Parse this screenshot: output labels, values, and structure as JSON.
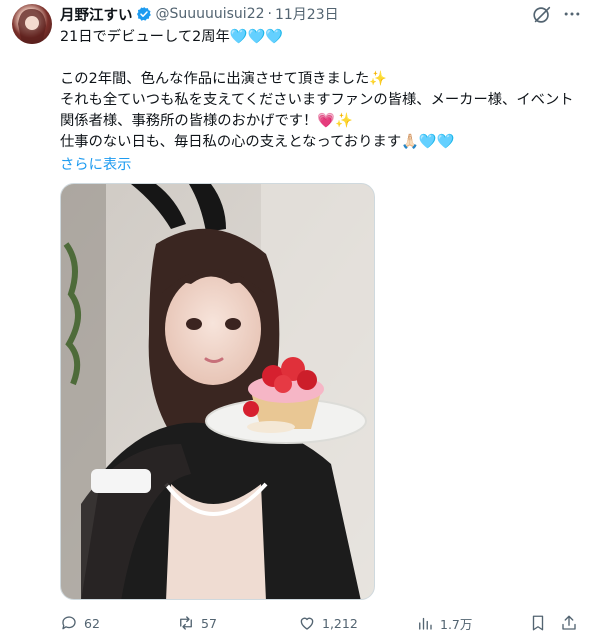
{
  "post": {
    "author_name": "月野江すい",
    "handle": "@Suuuuuisui22",
    "separator": "·",
    "date": "11月23日",
    "text": "21日でデビューして2周年🩵🩵🩵\n\nこの2年間、色んな作品に出演させて頂きました✨\nそれも全ていつも私を支えてくださいますファンの皆様、メーカー様、イベント関係者様、事務所の皆様のおかげです！💗✨\n仕事のない日も、毎日私の心の支えとなっております🙏🏻🩵🩵",
    "show_more": "さらに表示"
  },
  "actions": {
    "replies": "62",
    "reposts": "57",
    "likes": "1,212",
    "views": "1.7万"
  },
  "colors": {
    "accent": "#1d9bf0",
    "muted": "#536471",
    "verified": "#1d9bf0"
  },
  "icons": [
    "verified-badge-icon",
    "grok-icon",
    "more-icon",
    "reply-icon",
    "repost-icon",
    "like-icon",
    "views-icon",
    "bookmark-icon",
    "share-icon"
  ]
}
